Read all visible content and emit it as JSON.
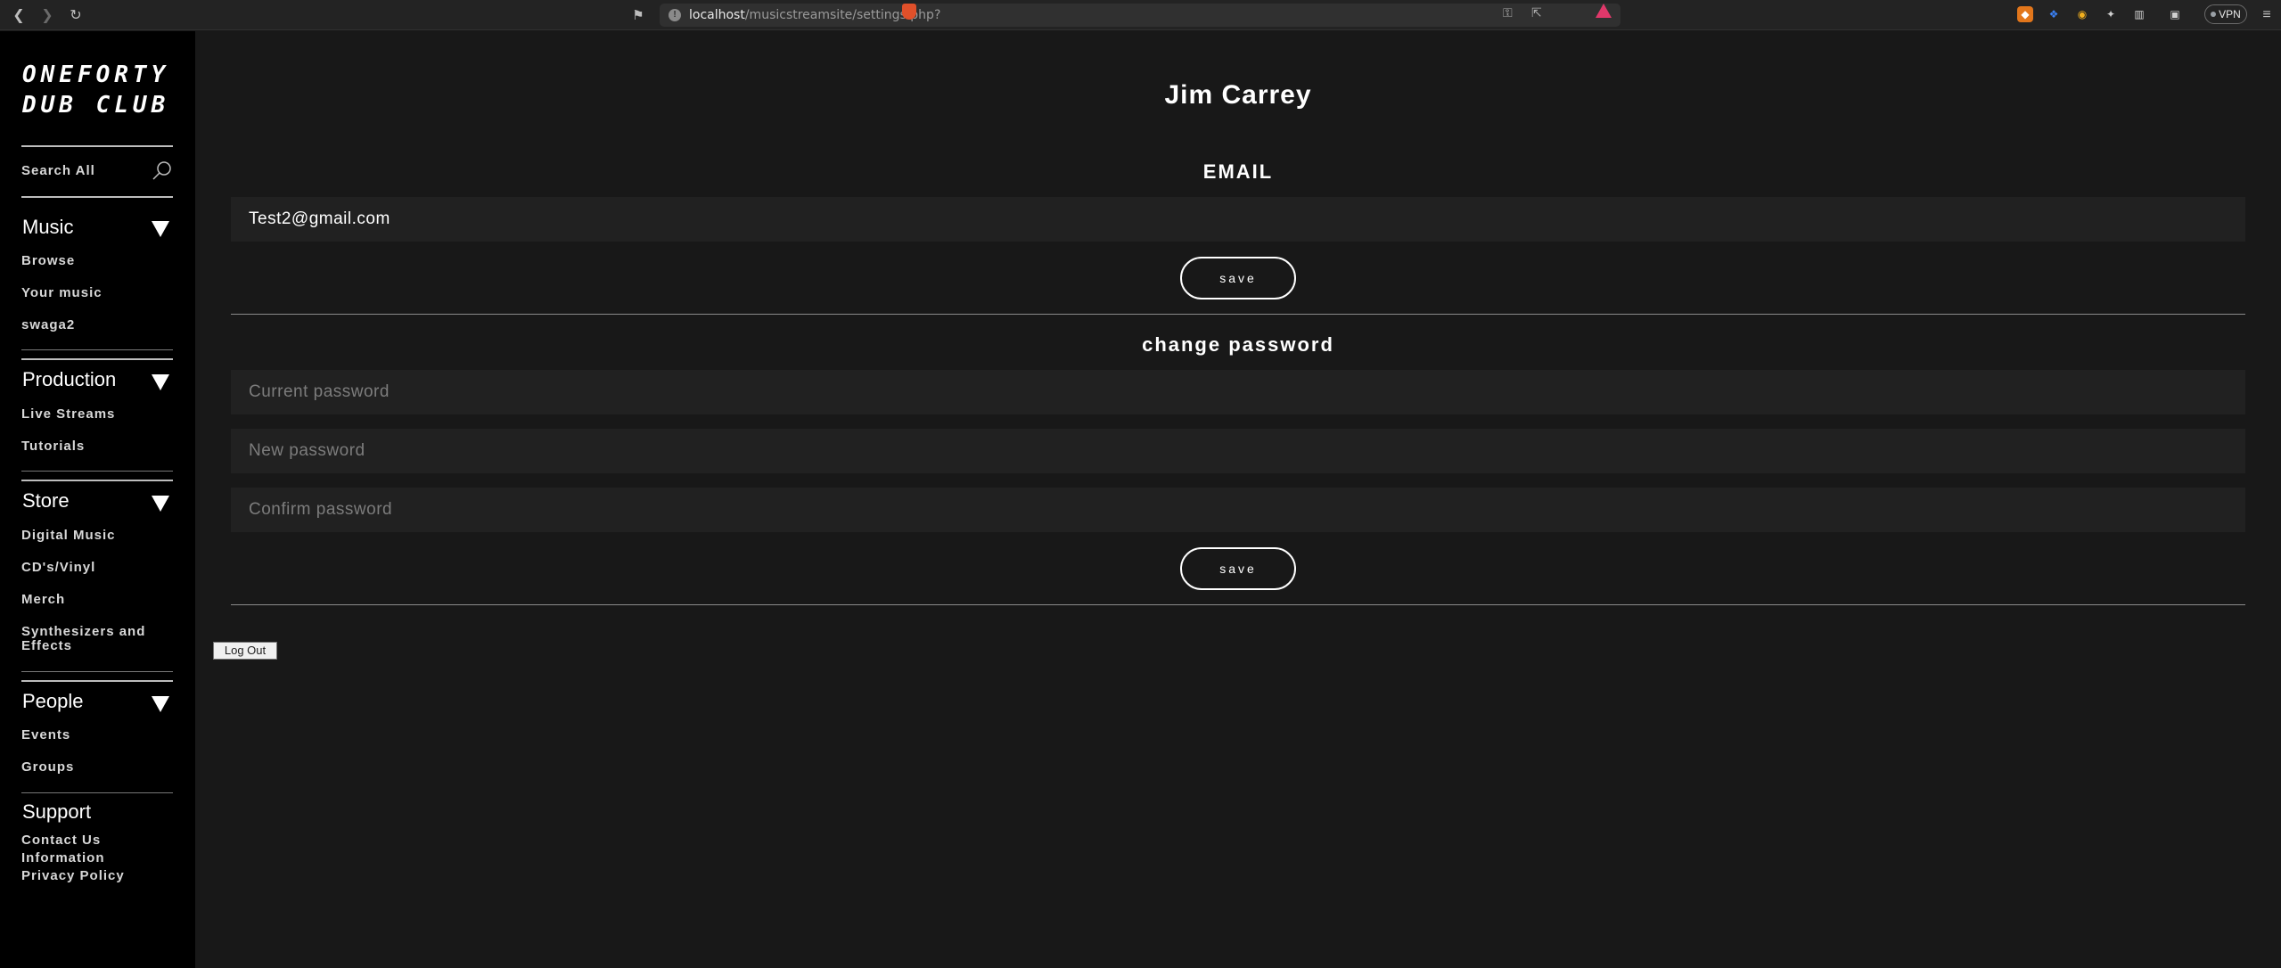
{
  "browser": {
    "url_host": "localhost",
    "url_path": "/musicstreamsite/settings.php?",
    "vpn_label": "VPN",
    "icons": [
      "back-arrow-icon",
      "forward-arrow-icon",
      "reload-icon",
      "bookmark-icon",
      "site-info-icon",
      "key-icon",
      "share-icon",
      "brave-shield-icon",
      "brave-rewards-icon",
      "metamask-icon",
      "extension-icon",
      "extensions-puzzle-icon",
      "sidebar-icon",
      "wallet-icon",
      "menu-icon"
    ]
  },
  "sidebar": {
    "logo_line1": "ONEFORTY",
    "logo_line2": "DUB CLUB",
    "search_label": "Search All",
    "sections": [
      {
        "title": "Music",
        "links": [
          "Browse",
          "Your music",
          "swaga2"
        ]
      },
      {
        "title": "Production",
        "links": [
          "Live Streams",
          "Tutorials"
        ]
      },
      {
        "title": "Store",
        "links": [
          "Digital Music",
          "CD's/Vinyl",
          "Merch",
          "Synthesizers and Effects"
        ]
      },
      {
        "title": "People",
        "links": [
          "Events",
          "Groups"
        ]
      },
      {
        "title": "Support",
        "links": [
          "Contact Us",
          "Information",
          "Privacy Policy"
        ]
      }
    ]
  },
  "main": {
    "profile_name": "Jim Carrey",
    "email_heading": "EMAIL",
    "email_value": "Test2@gmail.com",
    "save_label": "save",
    "password_heading": "change password",
    "current_password_placeholder": "Current password",
    "new_password_placeholder": "New password",
    "confirm_password_placeholder": "Confirm password",
    "logout_label": "Log Out"
  },
  "colors": {
    "sidebar_bg": "#000000",
    "page_bg": "#181818",
    "field_bg": "#212121",
    "text": "#ffffff"
  }
}
